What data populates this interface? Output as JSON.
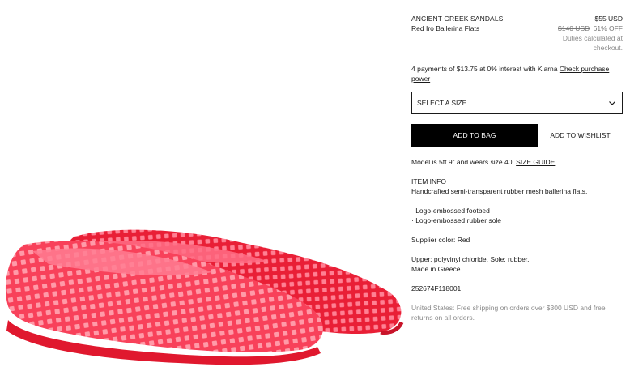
{
  "product": {
    "brand": "ANCIENT GREEK SANDALS",
    "name": "Red Iro Ballerina Flats",
    "price": "$55 USD",
    "original_price": "$140 USD",
    "discount": "61% OFF",
    "duties_note": "Duties calculated at checkout."
  },
  "klarna": {
    "text": "4 payments of $13.75 at 0% interest with Klarna ",
    "link": "Check purchase power"
  },
  "size_select": {
    "label": "SELECT A SIZE"
  },
  "actions": {
    "add_to_bag": "ADD TO BAG",
    "add_to_wishlist": "ADD TO WISHLIST"
  },
  "model_info": {
    "text": "Model is 5ft 9\" and wears size 40. ",
    "link": "SIZE GUIDE"
  },
  "item_info": {
    "heading": "ITEM INFO",
    "description": "Handcrafted semi-transparent rubber mesh ballerina flats.",
    "features": [
      "· Logo-embossed footbed",
      "· Logo-embossed rubber sole"
    ],
    "color": "Supplier color: Red",
    "materials": "Upper: polyvinyl chloride. Sole: rubber.",
    "origin": "Made in Greece.",
    "sku": "252674F118001"
  },
  "shipping": {
    "text": "United States: Free shipping on orders over $300 USD and free returns on all orders."
  },
  "colors": {
    "shoe_red": "#f0263a",
    "shoe_dark": "#c8142a",
    "button_bg": "#000000"
  }
}
